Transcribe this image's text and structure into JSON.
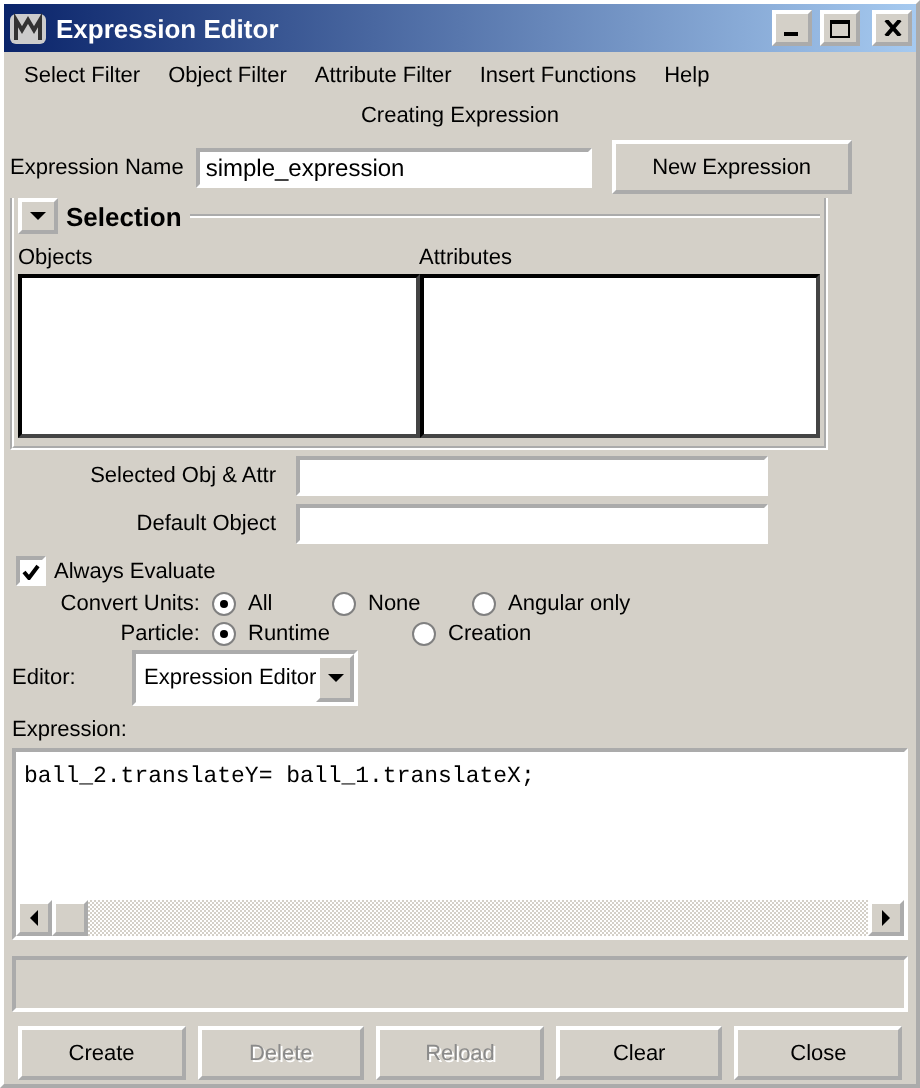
{
  "window": {
    "title": "Expression Editor"
  },
  "menu": [
    "Select Filter",
    "Object Filter",
    "Attribute Filter",
    "Insert Functions",
    "Help"
  ],
  "mode_caption": "Creating Expression",
  "expression_name": {
    "label": "Expression Name",
    "value": "simple_expression"
  },
  "new_expression_button": "New Expression",
  "selection": {
    "title": "Selection",
    "expanded": true,
    "columns": [
      "Objects",
      "Attributes"
    ]
  },
  "fields": [
    {
      "label": "Selected Obj & Attr"
    },
    {
      "label": "Default Object"
    }
  ],
  "always_evaluate": {
    "label": "Always Evaluate",
    "checked": true
  },
  "radio_groups": [
    {
      "label": "Convert Units:",
      "options": [
        {
          "label": "All",
          "selected": true
        },
        {
          "label": "None",
          "selected": false
        },
        {
          "label": "Angular only",
          "selected": false
        }
      ]
    },
    {
      "label": "Particle:",
      "options": [
        {
          "label": "Runtime",
          "selected": true
        },
        {
          "label": "Creation",
          "selected": false
        }
      ]
    }
  ],
  "editor": {
    "label": "Editor:",
    "value": "Expression Editor"
  },
  "expression": {
    "label": "Expression:",
    "text": "ball_2.translateY= ball_1.translateX;"
  },
  "buttons": [
    {
      "label": "Create",
      "disabled": false
    },
    {
      "label": "Delete",
      "disabled": true
    },
    {
      "label": "Reload",
      "disabled": true
    },
    {
      "label": "Clear",
      "disabled": false
    },
    {
      "label": "Close",
      "disabled": false
    }
  ]
}
